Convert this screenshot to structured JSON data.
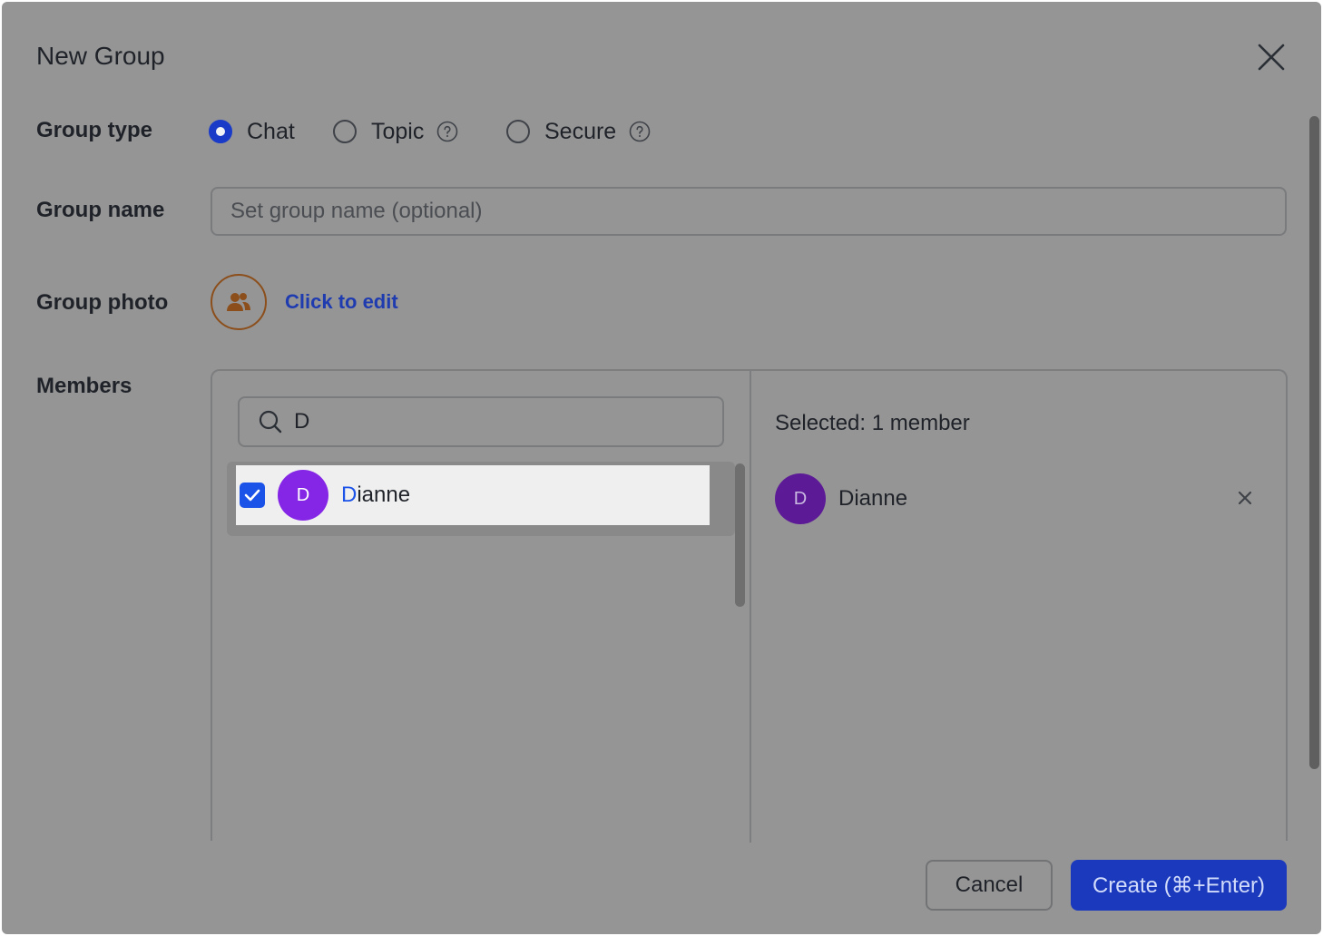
{
  "dialog": {
    "title": "New Group"
  },
  "group_type": {
    "label": "Group type",
    "options": [
      {
        "label": "Chat",
        "selected": true,
        "help": false
      },
      {
        "label": "Topic",
        "selected": false,
        "help": true
      },
      {
        "label": "Secure",
        "selected": false,
        "help": true
      }
    ]
  },
  "group_name": {
    "label": "Group name",
    "value": "",
    "placeholder": "Set group name (optional)"
  },
  "group_photo": {
    "label": "Group photo",
    "link": "Click to edit"
  },
  "members": {
    "label": "Members",
    "search_value": "D",
    "results": [
      {
        "initial": "D",
        "name_match": "D",
        "name_rest": "ianne",
        "checked": true
      }
    ],
    "selected_count_text": "Selected: 1 member",
    "selected": [
      {
        "initial": "D",
        "name": "Dianne"
      }
    ]
  },
  "buttons": {
    "cancel": "Cancel",
    "create": "Create (⌘+Enter)"
  },
  "colors": {
    "accent": "#1a39bd",
    "checkbox": "#1b52e8",
    "avatar_result": "#8526e6",
    "avatar_selected": "#5c1a96",
    "photo_ring": "#8c4f1c",
    "link": "#1f3bb0"
  },
  "icons": [
    "close-icon",
    "help-icon",
    "group-photo-icon",
    "search-icon",
    "check-icon",
    "remove-icon"
  ]
}
